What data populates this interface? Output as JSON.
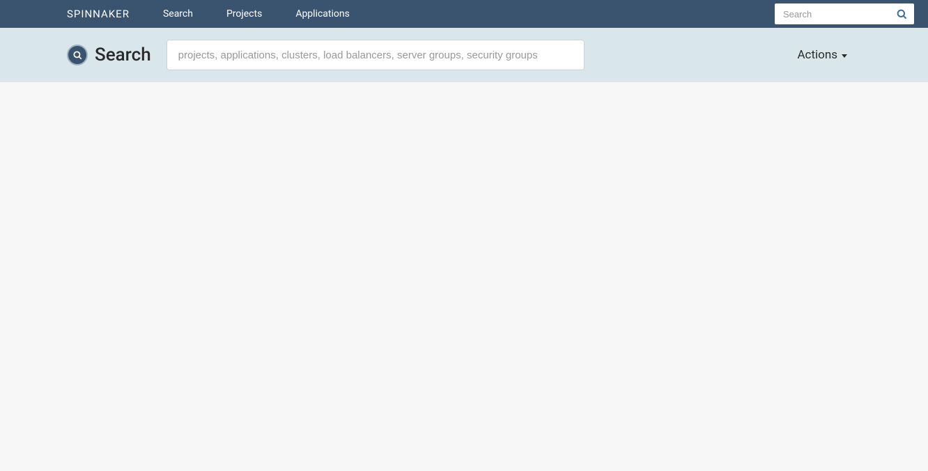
{
  "nav": {
    "brand": "SPINNAKER",
    "links": [
      "Search",
      "Projects",
      "Applications"
    ],
    "search_placeholder": "Search"
  },
  "subheader": {
    "title": "Search",
    "main_search_placeholder": "projects, applications, clusters, load balancers, server groups, security groups",
    "actions_label": "Actions"
  }
}
